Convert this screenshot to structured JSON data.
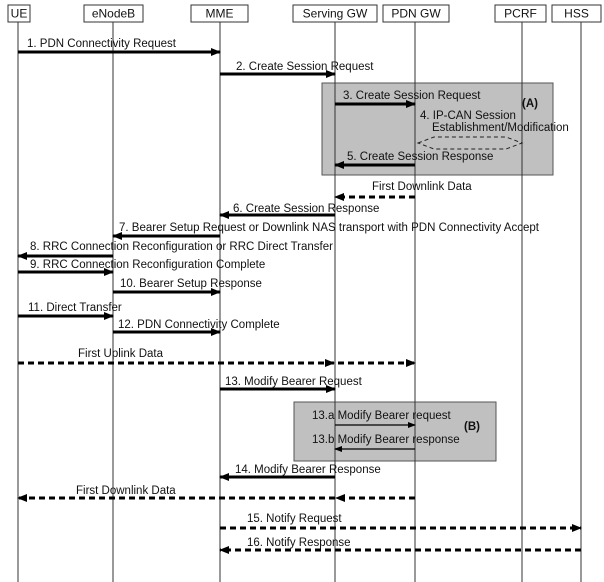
{
  "entities": [
    {
      "id": "ue",
      "label": "UE"
    },
    {
      "id": "enb",
      "label": "eNodeB"
    },
    {
      "id": "mme",
      "label": "MME"
    },
    {
      "id": "sgw",
      "label": "Serving GW"
    },
    {
      "id": "pgw",
      "label": "PDN GW"
    },
    {
      "id": "pcrf",
      "label": "PCRF"
    },
    {
      "id": "hss",
      "label": "HSS"
    }
  ],
  "groups": [
    {
      "id": "A",
      "label": "(A)",
      "fill": "#c0c0c0"
    },
    {
      "id": "B",
      "label": "(B)",
      "fill": "#c0c0c0"
    }
  ],
  "messages": [
    {
      "from": "ue",
      "to": "mme",
      "label": "1. PDN Connectivity Request",
      "style": "solid"
    },
    {
      "from": "mme",
      "to": "sgw",
      "label": "2. Create Session Request",
      "style": "solid"
    },
    {
      "from": "sgw",
      "to": "pgw",
      "label": "3. Create Session Request",
      "style": "solid"
    },
    {
      "from": "pgw",
      "to": "pcrf",
      "label": "4. IP-CAN Session",
      "label2": "Establishment/Modification",
      "style": "exchange"
    },
    {
      "from": "pgw",
      "to": "sgw",
      "label": "5. Create Session Response",
      "style": "solid"
    },
    {
      "from": "pgw",
      "to": "sgw",
      "label": "First Downlink Data",
      "style": "dashed"
    },
    {
      "from": "sgw",
      "to": "mme",
      "label": "6. Create Session Response",
      "style": "solid"
    },
    {
      "from": "mme",
      "to": "enb",
      "label": "7. Bearer Setup Request or Downlink NAS transport with PDN Connectivity Accept",
      "style": "solid"
    },
    {
      "from": "enb",
      "to": "ue",
      "label": "8. RRC Connection Reconfiguration or RRC Direct Transfer",
      "style": "solid"
    },
    {
      "from": "ue",
      "to": "enb",
      "label": "9. RRC Connection Reconfiguration Complete",
      "style": "solid"
    },
    {
      "from": "enb",
      "to": "mme",
      "label": "10. Bearer Setup Response",
      "style": "solid"
    },
    {
      "from": "ue",
      "to": "enb",
      "label": "11. Direct Transfer",
      "style": "solid"
    },
    {
      "from": "enb",
      "to": "mme",
      "label": "12. PDN Connectivity Complete",
      "style": "solid"
    },
    {
      "from": "ue",
      "to": "pgw",
      "label": "First  Uplink Data",
      "style": "dashed",
      "via": "sgw"
    },
    {
      "from": "mme",
      "to": "sgw",
      "label": "13. Modify Bearer Request",
      "style": "solid"
    },
    {
      "from": "sgw",
      "to": "pgw",
      "label": "13.a  Modify Bearer request",
      "style": "thin"
    },
    {
      "from": "pgw",
      "to": "sgw",
      "label": "13.b  Modify Bearer response",
      "style": "thin"
    },
    {
      "from": "sgw",
      "to": "mme",
      "label": "14. Modify Bearer Response",
      "style": "solid"
    },
    {
      "from": "pgw",
      "to": "ue",
      "label": "First Downlink Data",
      "style": "dashed",
      "via": "sgw"
    },
    {
      "from": "mme",
      "to": "hss",
      "label": "15. Notify Request",
      "style": "dashed"
    },
    {
      "from": "hss",
      "to": "mme",
      "label": "16. Notify Response",
      "style": "dashed"
    }
  ]
}
